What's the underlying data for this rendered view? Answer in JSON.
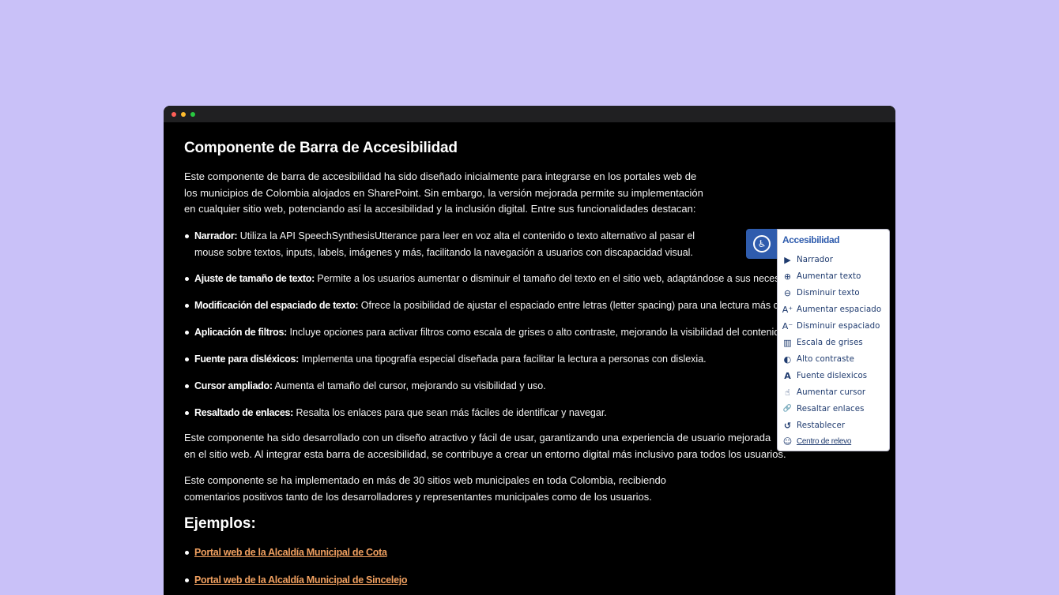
{
  "page": {
    "title": "Componente de Barra de Accesibilidad",
    "intro": [
      "Este componente de barra de accesibilidad ha sido diseñado inicialmente para integrarse en los portales web de",
      "los municipios de Colombia alojados en SharePoint. Sin embargo, la versión mejorada permite su implementación",
      "en cualquier sitio web, potenciando así la accesibilidad y la inclusión digital. Entre sus funcionalidades destacan:"
    ],
    "features": [
      {
        "label": "Narrador:",
        "lines": [
          " Utiliza la API SpeechSynthesisUtterance para leer en voz alta el contenido o texto alternativo al pasar el",
          "mouse sobre textos, inputs, labels, imágenes y más, facilitando la navegación a usuarios con discapacidad visual."
        ]
      },
      {
        "label": "Ajuste de tamaño de texto:",
        "lines": [
          " Permite a los usuarios aumentar o disminuir el tamaño del texto en el sitio web, adaptándose a sus necesida"
        ]
      },
      {
        "label": "Modificación del espaciado de texto:",
        "lines": [
          " Ofrece la posibilidad de ajustar el espaciado entre letras (letter spacing) para una lectura más cómo"
        ]
      },
      {
        "label": "Aplicación de filtros:",
        "lines": [
          " Incluye opciones para activar filtros como escala de grises o alto contraste, mejorando la visibilidad del contenido."
        ]
      },
      {
        "label": "Fuente para disléxicos:",
        "lines": [
          " Implementa una tipografía especial diseñada para facilitar la lectura a personas con dislexia."
        ]
      },
      {
        "label": "Cursor ampliado:",
        "lines": [
          " Aumenta el tamaño del cursor, mejorando su visibilidad y uso."
        ]
      },
      {
        "label": "Resaltado de enlaces:",
        "lines": [
          " Resalta los enlaces para que sean más fáciles de identificar y navegar."
        ]
      }
    ],
    "para2": [
      "Este componente ha sido desarrollado con un diseño atractivo y fácil de usar, garantizando una experiencia de usuario mejorada",
      "en el sitio web. Al integrar esta barra de accesibilidad, se contribuye a crear un entorno digital más inclusivo para todos los usuarios."
    ],
    "para3": [
      "Este componente se ha implementado en más de 30 sitios web municipales en toda Colombia, recibiendo",
      "comentarios positivos tanto de los desarrolladores y representantes municipales como de los usuarios."
    ],
    "examples_title": "Ejemplos:",
    "examples": [
      "Portal web de la Alcaldía Municipal de Cota",
      "Portal web de la Alcaldía Municipal de Sincelejo"
    ]
  },
  "widget": {
    "title": "Accesibilidad",
    "items": [
      {
        "label": "Narrador",
        "icon": "play-circle-icon",
        "glyph": "▶"
      },
      {
        "label": "Aumentar texto",
        "icon": "zoom-in-icon",
        "glyph": "⊕"
      },
      {
        "label": "Disminuir texto",
        "icon": "zoom-out-icon",
        "glyph": "⊖"
      },
      {
        "label": "Aumentar espaciado",
        "icon": "text-spacing-increase-icon",
        "glyph": "A⁺"
      },
      {
        "label": "Disminuir espaciado",
        "icon": "text-spacing-decrease-icon",
        "glyph": "A⁻"
      },
      {
        "label": "Escala de grises",
        "icon": "grayscale-icon",
        "glyph": "▥"
      },
      {
        "label": "Alto contraste",
        "icon": "contrast-icon",
        "glyph": "◐"
      },
      {
        "label": "Fuente dislexicos",
        "icon": "font-icon",
        "glyph": "A"
      },
      {
        "label": "Aumentar cursor",
        "icon": "pointer-icon",
        "glyph": "☝"
      },
      {
        "label": "Resaltar enlaces",
        "icon": "link-icon",
        "glyph": "🔗"
      },
      {
        "label": "Restablecer",
        "icon": "reset-icon",
        "glyph": "↺"
      },
      {
        "label": "Centro de relevo",
        "icon": "relay-center-icon",
        "glyph": "☺"
      }
    ]
  },
  "colors": {
    "background": "#c9c1f8",
    "accent": "#2f5cad",
    "link": "#f0a060"
  }
}
